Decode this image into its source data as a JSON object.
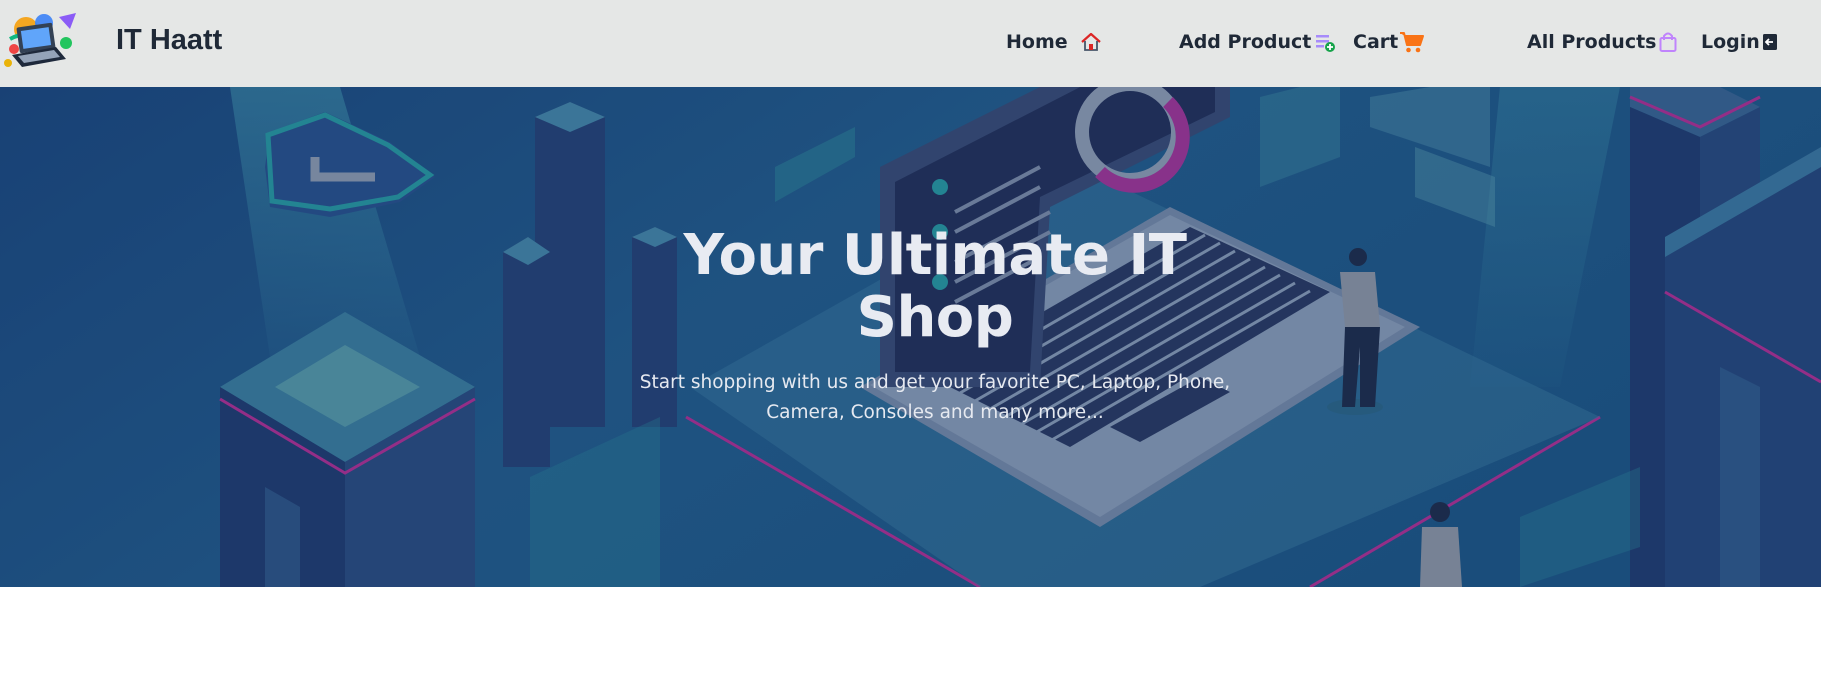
{
  "brand": {
    "name": "IT Haatt",
    "logo_icon": "laptop-shop-logo"
  },
  "nav": {
    "items": [
      {
        "label": "Home",
        "icon": "home-icon"
      },
      {
        "label": "Add Product",
        "icon": "add-product-icon"
      },
      {
        "label": "Cart",
        "icon": "cart-icon"
      },
      {
        "label": "All Products",
        "icon": "shopping-bag-icon"
      },
      {
        "label": "Login",
        "icon": "login-icon"
      }
    ]
  },
  "hero": {
    "title_line1": "Your Ultimate IT",
    "title_line2": "Shop",
    "subtitle_line1": "Start shopping with us and get your favorite PC, Laptop, Phone,",
    "subtitle_line2": "Camera, Consoles and many more..."
  },
  "colors": {
    "navbar_bg": "#e5e7e6",
    "hero_bg": "#1f4f85",
    "accent_magenta": "#c0309a",
    "accent_teal": "#2aa3a8",
    "cart_orange": "#f97316",
    "bag_purple": "#c084fc",
    "home_red": "#dc2626"
  }
}
